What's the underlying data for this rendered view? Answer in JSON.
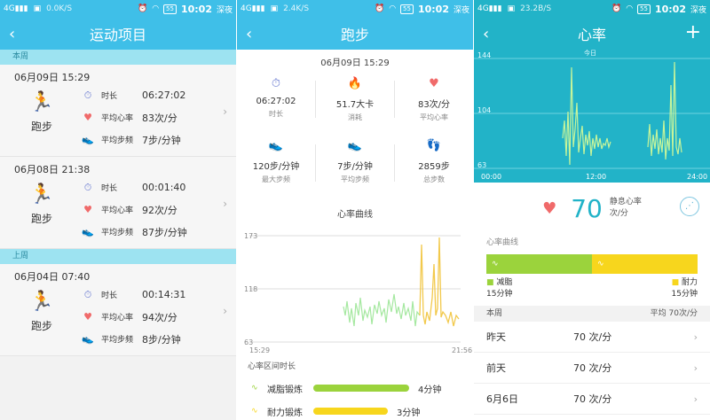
{
  "status": {
    "net1": "0.0K/S",
    "net2": "2.4K/S",
    "net3": "23.2B/S",
    "battery": "55",
    "time": "10:02",
    "mode": "深夜"
  },
  "p1": {
    "title": "运动项目",
    "sections": [
      {
        "label": "本周",
        "records": [
          {
            "date": "06月09日 15:29",
            "sport": "跑步",
            "duration_label": "时长",
            "duration": "06:27:02",
            "hr_label": "平均心率",
            "hr": "83次/分",
            "cad_label": "平均步频",
            "cad": "7步/分钟"
          },
          {
            "date": "06月08日 21:38",
            "sport": "跑步",
            "duration_label": "时长",
            "duration": "00:01:40",
            "hr_label": "平均心率",
            "hr": "92次/分",
            "cad_label": "平均步频",
            "cad": "87步/分钟"
          }
        ]
      },
      {
        "label": "上周",
        "records": [
          {
            "date": "06月04日 07:40",
            "sport": "跑步",
            "duration_label": "时长",
            "duration": "00:14:31",
            "hr_label": "平均心率",
            "hr": "94次/分",
            "cad_label": "平均步频",
            "cad": "8步/分钟"
          }
        ]
      }
    ]
  },
  "p2": {
    "title": "跑步",
    "date": "06月09日 15:29",
    "stats": [
      {
        "value": "06:27:02",
        "label": "时长"
      },
      {
        "value": "51.7大卡",
        "label": "消耗"
      },
      {
        "value": "83次/分",
        "label": "平均心率"
      },
      {
        "value": "120步/分钟",
        "label": "最大步频"
      },
      {
        "value": "7步/分钟",
        "label": "平均步频"
      },
      {
        "value": "2859步",
        "label": "总步数"
      }
    ],
    "chart_title": "心率曲线",
    "chart": {
      "ymax": "173",
      "ymid": "118",
      "ymin": "63",
      "xstart": "15:29",
      "xend": "21:56"
    },
    "zones_title": "心率区间时长",
    "zones": [
      {
        "name": "减脂锻炼",
        "time": "4分钟",
        "color": "#9bd33c"
      },
      {
        "name": "耐力锻炼",
        "time": "3分钟",
        "color": "#f7d61d"
      }
    ]
  },
  "p3": {
    "title": "心率",
    "chart": {
      "y1": "144",
      "y2": "104",
      "y3": "63",
      "today": "今日",
      "x1": "00:00",
      "x2": "12:00",
      "x3": "24:00"
    },
    "resting_value": "70",
    "resting_label": "静息心率",
    "resting_unit": "次/分",
    "curve_label": "心率曲线",
    "zone1": {
      "name": "减脂",
      "time": "15分钟"
    },
    "zone2": {
      "name": "耐力",
      "time": "15分钟"
    },
    "week_label": "本周",
    "week_avg": "平均 70次/分",
    "days": [
      {
        "day": "昨天",
        "value": "70 次/分"
      },
      {
        "day": "前天",
        "value": "70 次/分"
      },
      {
        "day": "6月6日",
        "value": "70 次/分"
      }
    ]
  }
}
